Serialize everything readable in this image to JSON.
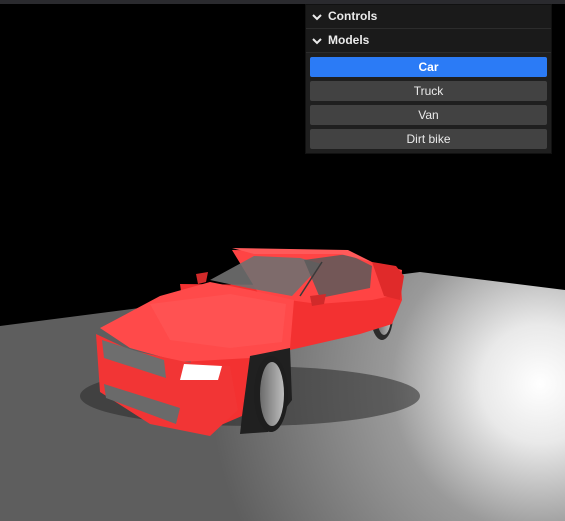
{
  "gui": {
    "controls_title": "Controls",
    "models_title": "Models",
    "models": [
      {
        "label": "Car",
        "selected": true
      },
      {
        "label": "Truck",
        "selected": false
      },
      {
        "label": "Van",
        "selected": false
      },
      {
        "label": "Dirt bike",
        "selected": false
      }
    ]
  },
  "colors": {
    "background": "#000000",
    "selected_button": "#2b7bf6",
    "button": "#424242",
    "panel": "#1f1f1f",
    "car_body": "#ff3b3b",
    "ground": "#7a7a7a"
  }
}
